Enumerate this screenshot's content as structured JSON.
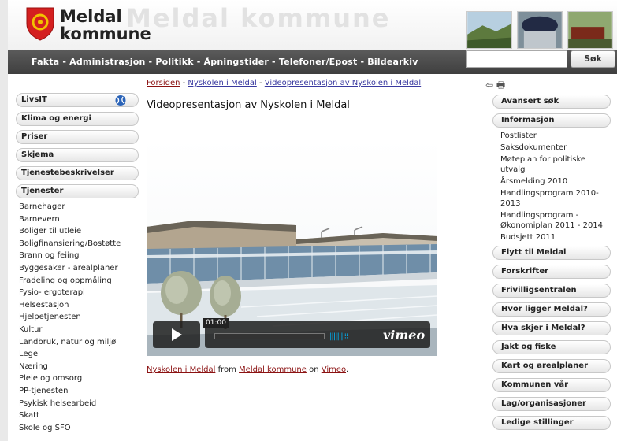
{
  "header": {
    "logo_line1": "Meldal",
    "logo_line2": "kommune",
    "logo_ghost": "Meldal kommune"
  },
  "nav": {
    "links": [
      "Fakta",
      "Administrasjon",
      "Politikk",
      "Åpningstider",
      "Telefoner/Epost",
      "Bildearkiv"
    ],
    "separator": " - "
  },
  "search": {
    "placeholder": "",
    "button_label": "Søk"
  },
  "breadcrumb": {
    "items": [
      "Forsiden",
      "Nyskolen i Meldal",
      "Videopresentasjon av Nyskolen i Meldal"
    ],
    "separator": " - "
  },
  "tools": {
    "back_icon": "⇦",
    "print_icon": "🖶"
  },
  "page_title": "Videopresentasjon av Nyskolen i Meldal",
  "video": {
    "time": "01:00",
    "brand": "vimeo"
  },
  "credit": {
    "video_link": "Nyskolen i Meldal",
    "from": "from",
    "user_link": "Meldal kommune",
    "on": "on",
    "site_link": "Vimeo",
    "end": "."
  },
  "left_sidebar": {
    "pills": [
      "LivsIT",
      "Klima og energi",
      "Priser",
      "Skjema",
      "Tjenestebeskrivelser",
      "Tjenester"
    ],
    "tjenester": [
      "Barnehager",
      "Barnevern",
      "Boliger til utleie",
      "Boligfinansiering/Bostøtte",
      "Brann og feiing",
      "Byggesaker - arealplaner",
      "Fradeling og oppmåling",
      "Fysio- ergoterapi",
      "Helsestasjon",
      "Hjelpetjenesten",
      "Kultur",
      "Landbruk, natur og miljø",
      "Lege",
      "Næring",
      "Pleie og omsorg",
      "PP-tjenesten",
      "Psykisk helsearbeid",
      "Skatt",
      "Skole og SFO"
    ]
  },
  "right_sidebar": {
    "avansert": "Avansert søk",
    "informasjon": "Informasjon",
    "info_items": [
      "Postlister",
      "Saksdokumenter",
      "Møteplan for politiske utvalg",
      "Årsmelding 2010",
      "Handlingsprogram 2010-2013",
      "Handlingsprogram - Økonomiplan 2011 - 2014",
      "Budsjett 2011"
    ],
    "pills": [
      "Flytt til Meldal",
      "Forskrifter",
      "Frivilligsentralen",
      "Hvor ligger Meldal?",
      "Hva skjer i Meldal?",
      "Jakt og fiske",
      "Kart og arealplaner",
      "Kommunen vår",
      "Lag/organisasjoner",
      "Ledige stillinger"
    ]
  },
  "colors": {
    "nav_bg": "#4a4a4a",
    "link_red": "#8b1111",
    "crest_red": "#d42020",
    "crest_gold": "#f2c200",
    "vimeo_blue": "#00adef"
  }
}
